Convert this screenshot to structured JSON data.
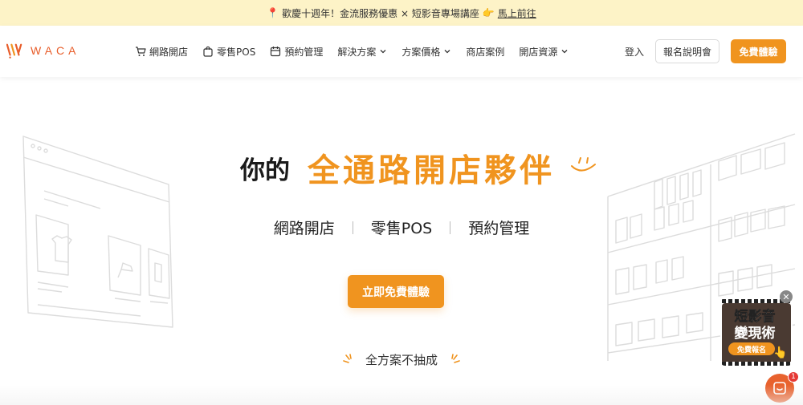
{
  "announcement": {
    "text": "歡慶十週年！金流服務優惠 × 短影音專場講座",
    "link": "馬上前往",
    "pin_icon": "pin-icon",
    "hand_icon": "pointing-hand-icon"
  },
  "brand": {
    "name": "WACA",
    "color": "#e85d2a"
  },
  "nav": {
    "items": [
      {
        "label": "網路開店",
        "icon": "cart-icon",
        "dropdown": false
      },
      {
        "label": "零售POS",
        "icon": "bag-icon",
        "dropdown": false
      },
      {
        "label": "預約管理",
        "icon": "calendar-icon",
        "dropdown": false
      },
      {
        "label": "解決方案",
        "icon": null,
        "dropdown": true
      },
      {
        "label": "方案價格",
        "icon": null,
        "dropdown": true
      },
      {
        "label": "商店案例",
        "icon": null,
        "dropdown": false
      },
      {
        "label": "開店資源",
        "icon": null,
        "dropdown": true
      }
    ],
    "login": "登入",
    "briefing": "報名說明會",
    "trial": "免費體驗"
  },
  "hero": {
    "prefix": "你的",
    "headline": "全通路開店夥伴",
    "subs": [
      "網路開店",
      "零售POS",
      "預約管理"
    ],
    "cta": "立即免費體驗",
    "note": "全方案不抽成"
  },
  "promo": {
    "line1": "短影音",
    "line2": "變現術",
    "button": "免費報名"
  },
  "chat": {
    "badge": "1"
  },
  "colors": {
    "accent": "#f0941f",
    "banner": "#fdf3c7"
  }
}
